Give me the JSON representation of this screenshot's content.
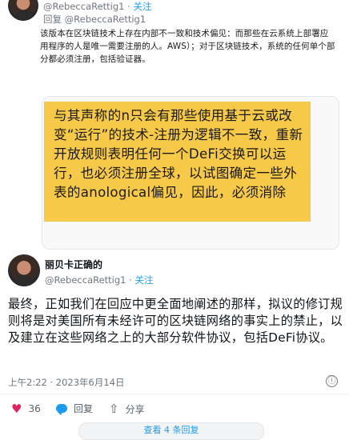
{
  "top_reply": {
    "handle": "@RebeccaRettig1",
    "separator": " · ",
    "follow": "关注",
    "reply_prefix": "回复",
    "reply_to": "@RebeccaRettig1"
  },
  "quoted_text": "该版本在区块链技术上存在内部不一致和技术偏见：而那些在云系统上部署应用程序的人是唯一需要注册的人。AWS）；对于区块链技术，系统的任何单个部分都必须注册，包括验证器。",
  "image_text": "与其声称的n只会有那些使用基于云或改变“运行”的技术-注册为逻辑不一致，重新开放规则表明任何一个DeFi交换可以运行，也必须注册全球，以试图确定一些外表的anological偏见，因此，必须消除",
  "tweet": {
    "display_name": "丽贝卡正确的",
    "handle": "@RebeccaRettig1",
    "separator": " · ",
    "follow": "关注",
    "body": "最终，正如我们在回应中更全面地阐述的那样，拟议的修订规则将是对美国所有未经许可的区块链网络的事实上的禁止，以及建立在这些网络之上的大部分软件协议，包括DeFi协议。",
    "timestamp": "上午2:22 · 2023年6月14日",
    "info_icon": "ⓘ"
  },
  "actions": {
    "like_count": "36",
    "reply_label": "回复",
    "share_label": "分享"
  },
  "bottom_button": "查看 4 条回复",
  "icons": [
    "heart-icon",
    "reply-bubble-icon",
    "share-icon",
    "info-icon"
  ],
  "colors": {
    "accent": "#1d9bf0",
    "like": "#e0245e",
    "highlight": "#f7c948"
  }
}
